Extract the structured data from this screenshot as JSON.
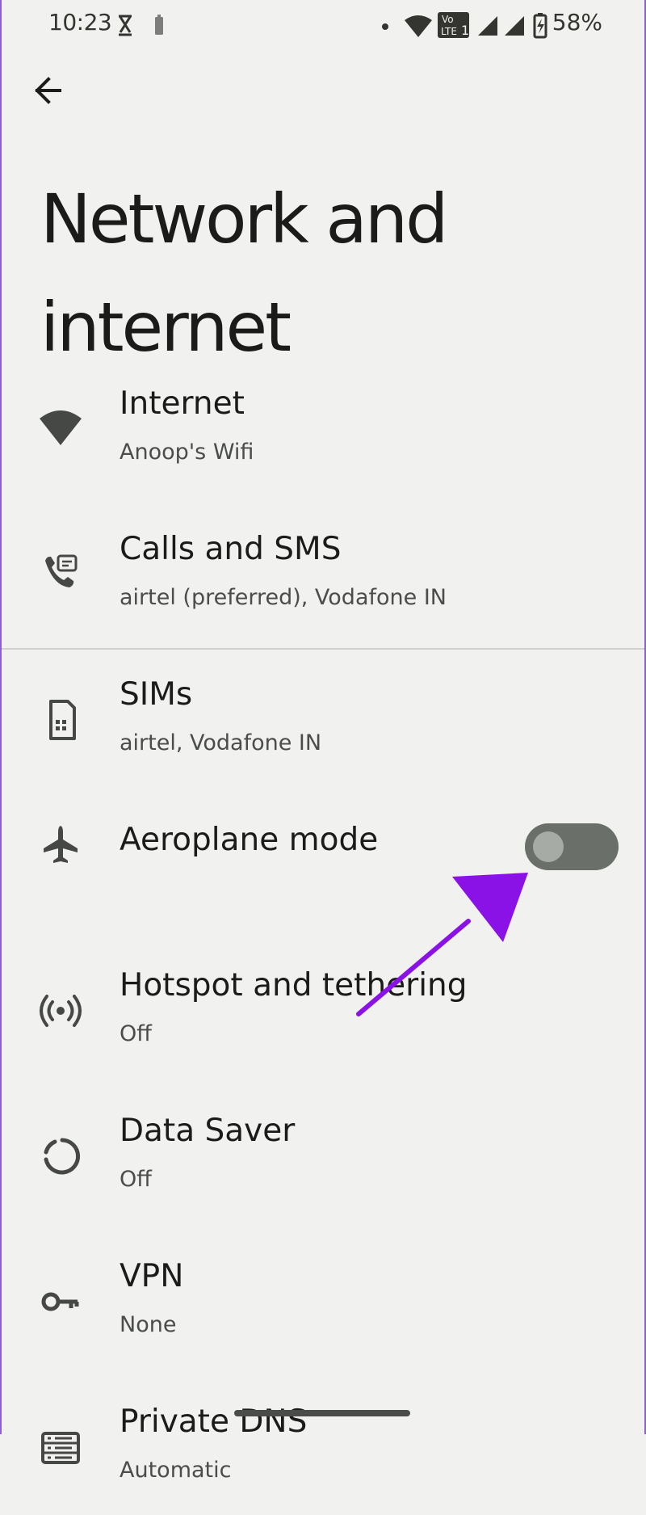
{
  "status_bar": {
    "time": "10:23",
    "battery": "58%",
    "icons": [
      "hourglass-icon",
      "battery-saver-icon",
      "dot-icon",
      "wifi-icon",
      "volte-icon",
      "signal-icon",
      "signal-icon",
      "battery-icon"
    ],
    "volte_label": "Vo LTE 1"
  },
  "header": {
    "title": "Network and internet"
  },
  "settings": [
    {
      "title": "Internet",
      "subtitle": "Anoop's Wifi",
      "icon": "wifi-icon"
    },
    {
      "title": "Calls and SMS",
      "subtitle": "airtel (preferred), Vodafone IN",
      "icon": "phone-sms-icon"
    },
    {
      "title": "SIMs",
      "subtitle": "airtel, Vodafone IN",
      "icon": "sim-card-icon"
    },
    {
      "title": "Aeroplane mode",
      "subtitle": "",
      "icon": "airplane-icon"
    },
    {
      "title": "Hotspot and tethering",
      "subtitle": "Off",
      "icon": "hotspot-icon"
    },
    {
      "title": "Data Saver",
      "subtitle": "Off",
      "icon": "data-saver-icon"
    },
    {
      "title": "VPN",
      "subtitle": "None",
      "icon": "vpn-key-icon"
    },
    {
      "title": "Private DNS",
      "subtitle": "Automatic",
      "icon": "dns-icon"
    }
  ],
  "aeroplane_mode": {
    "enabled": false
  },
  "colors": {
    "background": "#f1f1ef",
    "primary_text": "#1b1c19",
    "secondary_text": "#4a4d49",
    "icon": "#454844",
    "toggle_track": "#6a6f69",
    "toggle_knob": "#a6aba5",
    "annotation": "#8a12e6",
    "frame": "#8d5fd3"
  }
}
